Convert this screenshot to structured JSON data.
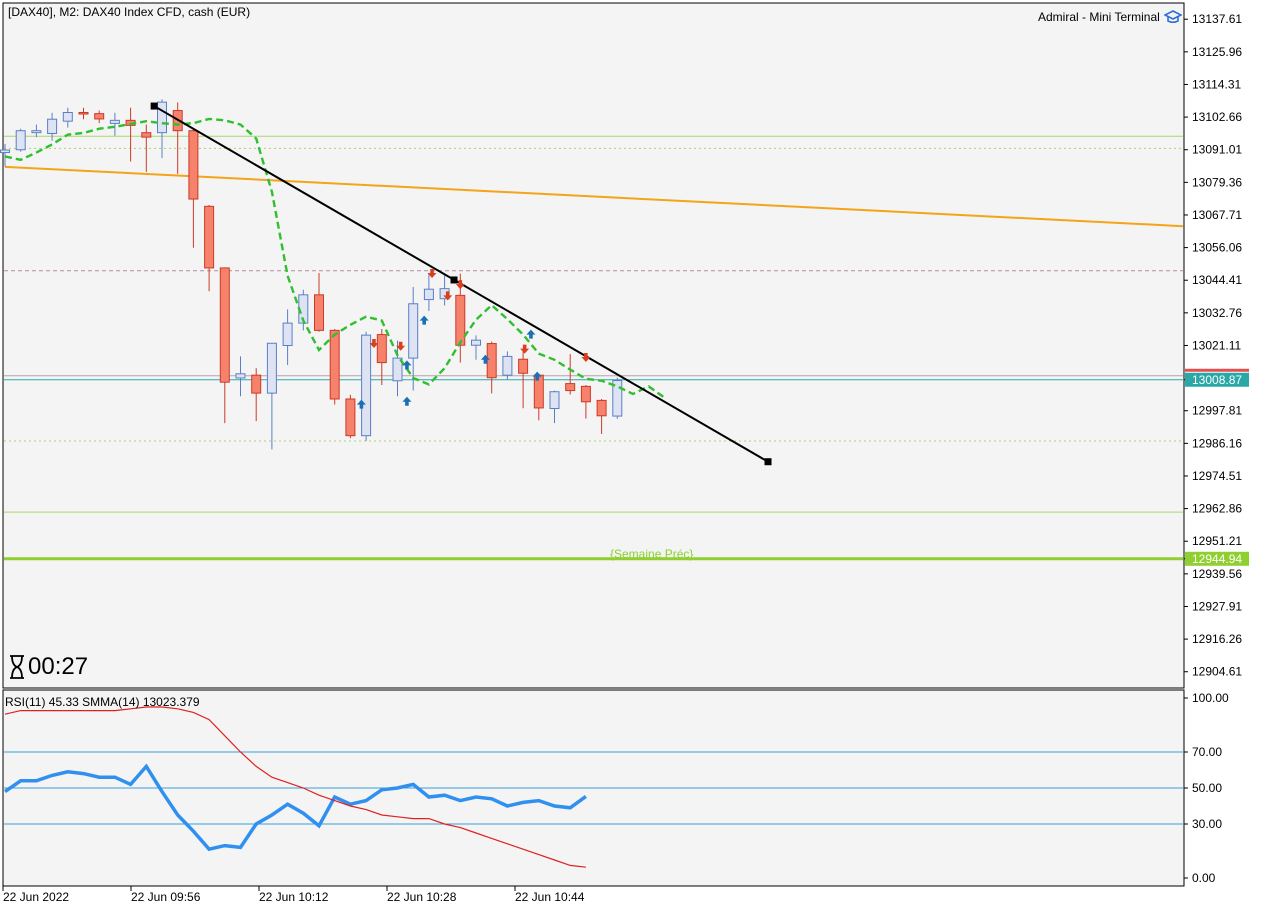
{
  "header": {
    "symbol_info": "[DAX40], M2:  DAX40 Index CFD, cash (EUR)",
    "terminal_label": "Admiral - Mini Terminal"
  },
  "timer": {
    "icon": "hourglass-icon",
    "value": "00:27"
  },
  "rsi_panel": {
    "label": "RSI(11) 45.33 SMMA(14) 13023.379"
  },
  "colors": {
    "background": "#f4f4f4",
    "bull_body": "#dde3f2",
    "bull_border": "#5b7fc6",
    "bear_body": "#f6826c",
    "bear_border": "#cc3a28",
    "ma_line": "#2fbf2f",
    "trend_line": "#000000",
    "orange_line": "#f5a319",
    "green_level": "#8fcf2f",
    "rsi_line": "#3090f0",
    "smma_line": "#e02020",
    "current_price_bg": "#2aa8a8",
    "week_level_bg": "#8fcf2f"
  },
  "chart_data": [
    {
      "type": "candlestick",
      "title": "[DAX40], M2:  DAX40 Index CFD, cash (EUR)",
      "y_ticks": [
        "13137.61",
        "13125.96",
        "13114.31",
        "13102.66",
        "13091.01",
        "13079.36",
        "13067.71",
        "13056.06",
        "13044.41",
        "13032.76",
        "13021.11",
        "13008.87",
        "12997.81",
        "12986.16",
        "12974.51",
        "12962.86",
        "12951.21",
        "12944.94",
        "12939.56",
        "12927.91",
        "12916.26",
        "12904.61"
      ],
      "ylim": [
        12898.8,
        13143.4
      ],
      "candles": [
        {
          "o": 13090.0,
          "h": 13093.1,
          "l": 13085.0,
          "c": 13090.9
        },
        {
          "o": 13091.0,
          "h": 13098.5,
          "l": 13090.3,
          "c": 13097.8
        },
        {
          "o": 13097.1,
          "h": 13100.0,
          "l": 13095.5,
          "c": 13097.8
        },
        {
          "o": 13096.8,
          "h": 13104.2,
          "l": 13094.2,
          "c": 13101.9
        },
        {
          "o": 13101.2,
          "h": 13106.0,
          "l": 13098.9,
          "c": 13104.3
        },
        {
          "o": 13104.3,
          "h": 13106.0,
          "l": 13101.9,
          "c": 13103.9
        },
        {
          "o": 13103.9,
          "h": 13105.0,
          "l": 13100.5,
          "c": 13102.0
        },
        {
          "o": 13100.4,
          "h": 13104.2,
          "l": 13096.0,
          "c": 13101.5
        },
        {
          "o": 13101.5,
          "h": 13106.0,
          "l": 13086.8,
          "c": 13099.7
        },
        {
          "o": 13097.1,
          "h": 13100.0,
          "l": 13083.1,
          "c": 13095.5
        },
        {
          "o": 13097.1,
          "h": 13109.0,
          "l": 13088.0,
          "c": 13108.0
        },
        {
          "o": 13105.0,
          "h": 13107.9,
          "l": 13082.4,
          "c": 13097.8
        },
        {
          "o": 13097.8,
          "h": 13098.5,
          "l": 13056.0,
          "c": 13073.4
        },
        {
          "o": 13070.8,
          "h": 13071.3,
          "l": 13040.5,
          "c": 13048.8
        },
        {
          "o": 13048.8,
          "h": 13049.0,
          "l": 12993.4,
          "c": 13008.0
        },
        {
          "o": 13009.5,
          "h": 13017.2,
          "l": 13003.0,
          "c": 13011.0
        },
        {
          "o": 13010.5,
          "h": 13013.0,
          "l": 12994.1,
          "c": 13004.1
        },
        {
          "o": 13004.1,
          "h": 13022.0,
          "l": 12984.0,
          "c": 13021.9
        },
        {
          "o": 13021.1,
          "h": 13034.0,
          "l": 13014.1,
          "c": 13029.1
        },
        {
          "o": 13029.1,
          "h": 13041.0,
          "l": 13026.5,
          "c": 13039.2
        },
        {
          "o": 13039.2,
          "h": 13047.0,
          "l": 13026.0,
          "c": 13026.5
        },
        {
          "o": 13026.5,
          "h": 13027.0,
          "l": 13000.0,
          "c": 13002.0
        },
        {
          "o": 13002.0,
          "h": 13003.5,
          "l": 12988.0,
          "c": 12988.9
        },
        {
          "o": 12988.9,
          "h": 13026.0,
          "l": 12987.0,
          "c": 13024.8
        },
        {
          "o": 13025.0,
          "h": 13027.0,
          "l": 13007.0,
          "c": 13015.0
        },
        {
          "o": 13008.5,
          "h": 13022.9,
          "l": 13003.0,
          "c": 13016.6
        },
        {
          "o": 13016.6,
          "h": 13042.0,
          "l": 13005.0,
          "c": 13036.0
        },
        {
          "o": 13037.5,
          "h": 13047.0,
          "l": 13033.4,
          "c": 13041.2
        },
        {
          "o": 13037.8,
          "h": 13046.5,
          "l": 13035.4,
          "c": 13041.4
        },
        {
          "o": 13039.0,
          "h": 13046.8,
          "l": 13015.0,
          "c": 13021.2
        },
        {
          "o": 13021.2,
          "h": 13024.7,
          "l": 13016.0,
          "c": 13023.0
        },
        {
          "o": 13021.8,
          "h": 13022.5,
          "l": 13004.0,
          "c": 13009.6
        },
        {
          "o": 13010.5,
          "h": 13019.0,
          "l": 13009.0,
          "c": 13017.2
        },
        {
          "o": 13016.2,
          "h": 13019.5,
          "l": 12998.7,
          "c": 13011.2
        },
        {
          "o": 13010.5,
          "h": 13011.0,
          "l": 12994.4,
          "c": 12998.8
        },
        {
          "o": 12998.6,
          "h": 13005.0,
          "l": 12993.4,
          "c": 13004.6
        },
        {
          "o": 13007.5,
          "h": 13018.0,
          "l": 13003.6,
          "c": 13005.0
        },
        {
          "o": 13006.5,
          "h": 13007.0,
          "l": 12995.0,
          "c": 13001.0
        },
        {
          "o": 13001.5,
          "h": 13002.0,
          "l": 12989.5,
          "c": 12996.0
        },
        {
          "o": 12995.9,
          "h": 13009.6,
          "l": 12994.9,
          "c": 13008.6
        }
      ],
      "ma_values": [
        13088.6,
        13087.4,
        13090.0,
        13092.9,
        13096.4,
        13097.0,
        13098.5,
        13099.2,
        13100.2,
        13101.2,
        13100.5,
        13100.0,
        13100.5,
        13102.0,
        13101.5,
        13100.0,
        13095.0,
        13076.0,
        13046.0,
        13030.0,
        13019.5,
        13025.0,
        13028.5,
        13031.4,
        13030.0,
        13017.6,
        13009.5,
        13007.2,
        13013.0,
        13022.2,
        13030.3,
        13035.5,
        13030.5,
        13025.0,
        13018.2,
        13016.0,
        13012.5,
        13009.2,
        13008.5,
        13006.5,
        13003.8,
        13006.5,
        13002.5
      ],
      "levels": [
        {
          "value": 13095.8,
          "style": "solid"
        },
        {
          "value": 13091.5,
          "style": "dotted"
        },
        {
          "value": 13047.8,
          "style": "dashed"
        },
        {
          "value": 13008.87,
          "style": "current-price"
        },
        {
          "value": 12987.0,
          "style": "dotted"
        },
        {
          "value": 12961.6,
          "style": "solid"
        },
        {
          "value": 12944.94,
          "style": "weekly"
        }
      ],
      "week_label": "{Semaine Préc}",
      "current_price": "13008.87",
      "week_level_price": "12944.94",
      "trend_line": {
        "from": [
          9.5,
          13106.6
        ],
        "to": [
          48.6,
          12979.6
        ]
      },
      "orange_line": {
        "from": [
          0,
          13084.9
        ],
        "to": [
          80,
          13063.7
        ]
      },
      "buy_arrows": [
        [
          22.7,
          13000
        ],
        [
          25.6,
          13001
        ],
        [
          25.6,
          13014
        ],
        [
          26.7,
          13030
        ],
        [
          30.6,
          13016
        ],
        [
          33.5,
          13025
        ],
        [
          33.9,
          13010
        ]
      ],
      "sell_arrows": [
        [
          23.5,
          13022
        ],
        [
          25.2,
          13021
        ],
        [
          27.2,
          13047
        ],
        [
          28.2,
          13039
        ],
        [
          29.0,
          13043
        ],
        [
          33.1,
          13020
        ],
        [
          37.0,
          13017
        ]
      ]
    },
    {
      "type": "line",
      "title": "RSI(11) 45.33 SMMA(14) 13023.379",
      "y_ticks": [
        "100.00",
        "70.00",
        "50.00",
        "30.00",
        "0.00"
      ],
      "ylim": [
        0,
        100
      ],
      "levels": [
        70,
        50,
        30
      ],
      "series": [
        {
          "name": "RSI(11)",
          "values": [
            48,
            54,
            54,
            57,
            59,
            58,
            56,
            56,
            52,
            62,
            48,
            35,
            26,
            16,
            18,
            17,
            30,
            35,
            41,
            36,
            29,
            45,
            41,
            43,
            49,
            50,
            52,
            45,
            46,
            43,
            45,
            44,
            40,
            42,
            43,
            40,
            39,
            45.33
          ]
        },
        {
          "values": [
            91,
            93,
            93,
            93,
            93,
            93,
            93,
            93,
            94,
            95,
            95,
            94,
            92,
            88,
            79,
            70,
            62,
            56,
            53,
            50,
            46,
            43,
            40,
            38,
            35,
            34,
            33,
            33,
            30,
            28,
            25,
            22,
            19,
            16,
            13,
            10,
            7,
            6
          ]
        }
      ],
      "x_tick_labels": [
        "22 Jun 2022",
        "22 Jun 09:56",
        "22 Jun 10:12",
        "22 Jun 10:28",
        "22 Jun 10:44"
      ]
    }
  ]
}
